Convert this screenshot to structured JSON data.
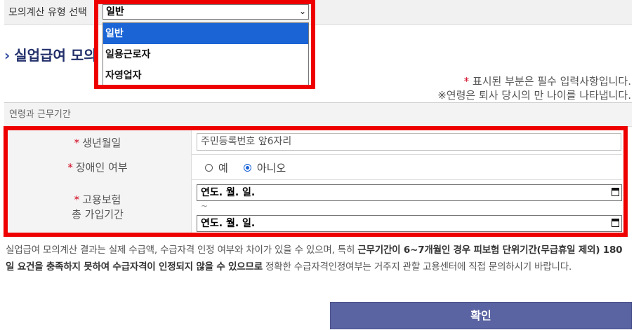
{
  "type_selector": {
    "label": "모의계산 유형 선택",
    "selected": "일반",
    "options": [
      "일반",
      "일용근로자",
      "자영업자"
    ]
  },
  "section_title": "실업급여 모의",
  "notes": {
    "required_star": "*",
    "required_text": "표시된 부분은 필수 입력사항입니다.",
    "age_note": "※연령은 퇴사 당시의 만 나이를 나타냅니다."
  },
  "form": {
    "caption": "연령과 근무기간",
    "birth": {
      "label": "생년월일",
      "placeholder": "주민등록번호 앞6자리"
    },
    "disability": {
      "label": "장애인 여부",
      "options": [
        "예",
        "아니오"
      ],
      "selected": "아니오"
    },
    "insurance": {
      "label_line1": "고용보험",
      "label_line2": "총 가입기간",
      "start_placeholder": "연도. 월. 일.",
      "separator": "~",
      "end_placeholder": "연도. 월. 일."
    }
  },
  "notice": {
    "part1": "실업급여 모의계산 결과는 실제 수급액, 수급자격 인정 여부와 차이가 있을 수 있으며, 특히 ",
    "bold": "근무기간이 6~7개월인 경우 피보험 단위기간(무급휴일 제외) 180일 요건을 충족하지 못하여 수급자격이 인정되지 않을 수 있으므로",
    "part2": " 정확한 수급자격인정여부는 거주지 관할 고용센터에 직접 문의하시기 바랍니다."
  },
  "confirm_button": "확인",
  "colors": {
    "highlight": "#ee0000",
    "selected_option": "#1a64d6",
    "button": "#5b64a3",
    "title": "#23306b",
    "required": "#d0021b"
  }
}
